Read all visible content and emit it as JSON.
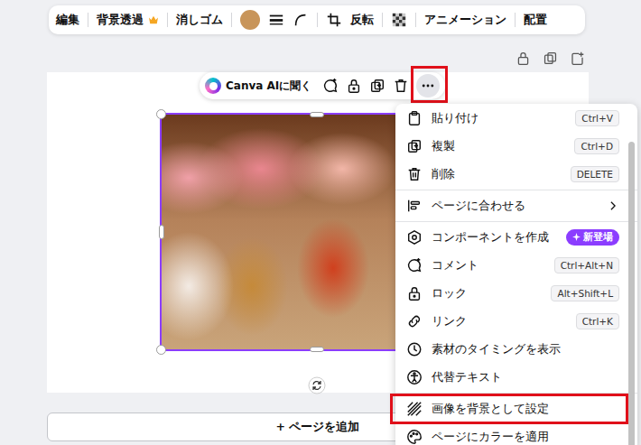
{
  "toolbar": {
    "items": [
      {
        "kind": "button",
        "label": "編集",
        "premium": false
      },
      {
        "kind": "sep"
      },
      {
        "kind": "button",
        "label": "背景透過",
        "premium": true
      },
      {
        "kind": "sep"
      },
      {
        "kind": "button",
        "label": "消しゴム",
        "premium": false
      },
      {
        "kind": "sep"
      },
      {
        "kind": "swatch",
        "color": "#c8955a"
      },
      {
        "kind": "icon"
      },
      {
        "kind": "icon"
      },
      {
        "kind": "sep"
      },
      {
        "kind": "icon"
      },
      {
        "kind": "button",
        "label": "反転",
        "premium": false
      },
      {
        "kind": "sep"
      },
      {
        "kind": "icon"
      },
      {
        "kind": "sep"
      },
      {
        "kind": "button",
        "label": "アニメーション",
        "premium": false
      },
      {
        "kind": "sep"
      },
      {
        "kind": "button",
        "label": "配置",
        "premium": false
      }
    ]
  },
  "element_toolbar": {
    "ai_label": "Canva AIに聞く",
    "more": {
      "selected": true,
      "highlighted": true
    }
  },
  "canvas": {
    "image": {
      "selected": true
    }
  },
  "add_page": {
    "label": "+ ページを追加"
  },
  "context_menu": {
    "items": [
      {
        "kind": "item",
        "label": "貼り付け",
        "shortcut": "Ctrl+V",
        "highlighted": false
      },
      {
        "kind": "item",
        "label": "複製",
        "shortcut": "Ctrl+D",
        "highlighted": false
      },
      {
        "kind": "item",
        "label": "削除",
        "shortcut": "DELETE",
        "highlighted": false
      },
      {
        "kind": "divider"
      },
      {
        "kind": "submenu",
        "label": "ページに合わせる",
        "highlighted": false
      },
      {
        "kind": "divider"
      },
      {
        "kind": "item",
        "label": "コンポーネントを作成",
        "badge": "新登場",
        "highlighted": false
      },
      {
        "kind": "item",
        "label": "コメント",
        "shortcut": "Ctrl+Alt+N",
        "highlighted": false
      },
      {
        "kind": "item",
        "label": "ロック",
        "shortcut": "Alt+Shift+L",
        "highlighted": false
      },
      {
        "kind": "item",
        "label": "リンク",
        "shortcut": "Ctrl+K",
        "highlighted": false
      },
      {
        "kind": "item",
        "label": "素材のタイミングを表示",
        "highlighted": false
      },
      {
        "kind": "item",
        "label": "代替テキスト",
        "highlighted": false
      },
      {
        "kind": "divider"
      },
      {
        "kind": "item",
        "label": "画像を背景として設定",
        "highlighted": true
      },
      {
        "kind": "item",
        "label": "ページにカラーを適用",
        "highlighted": false
      }
    ]
  }
}
